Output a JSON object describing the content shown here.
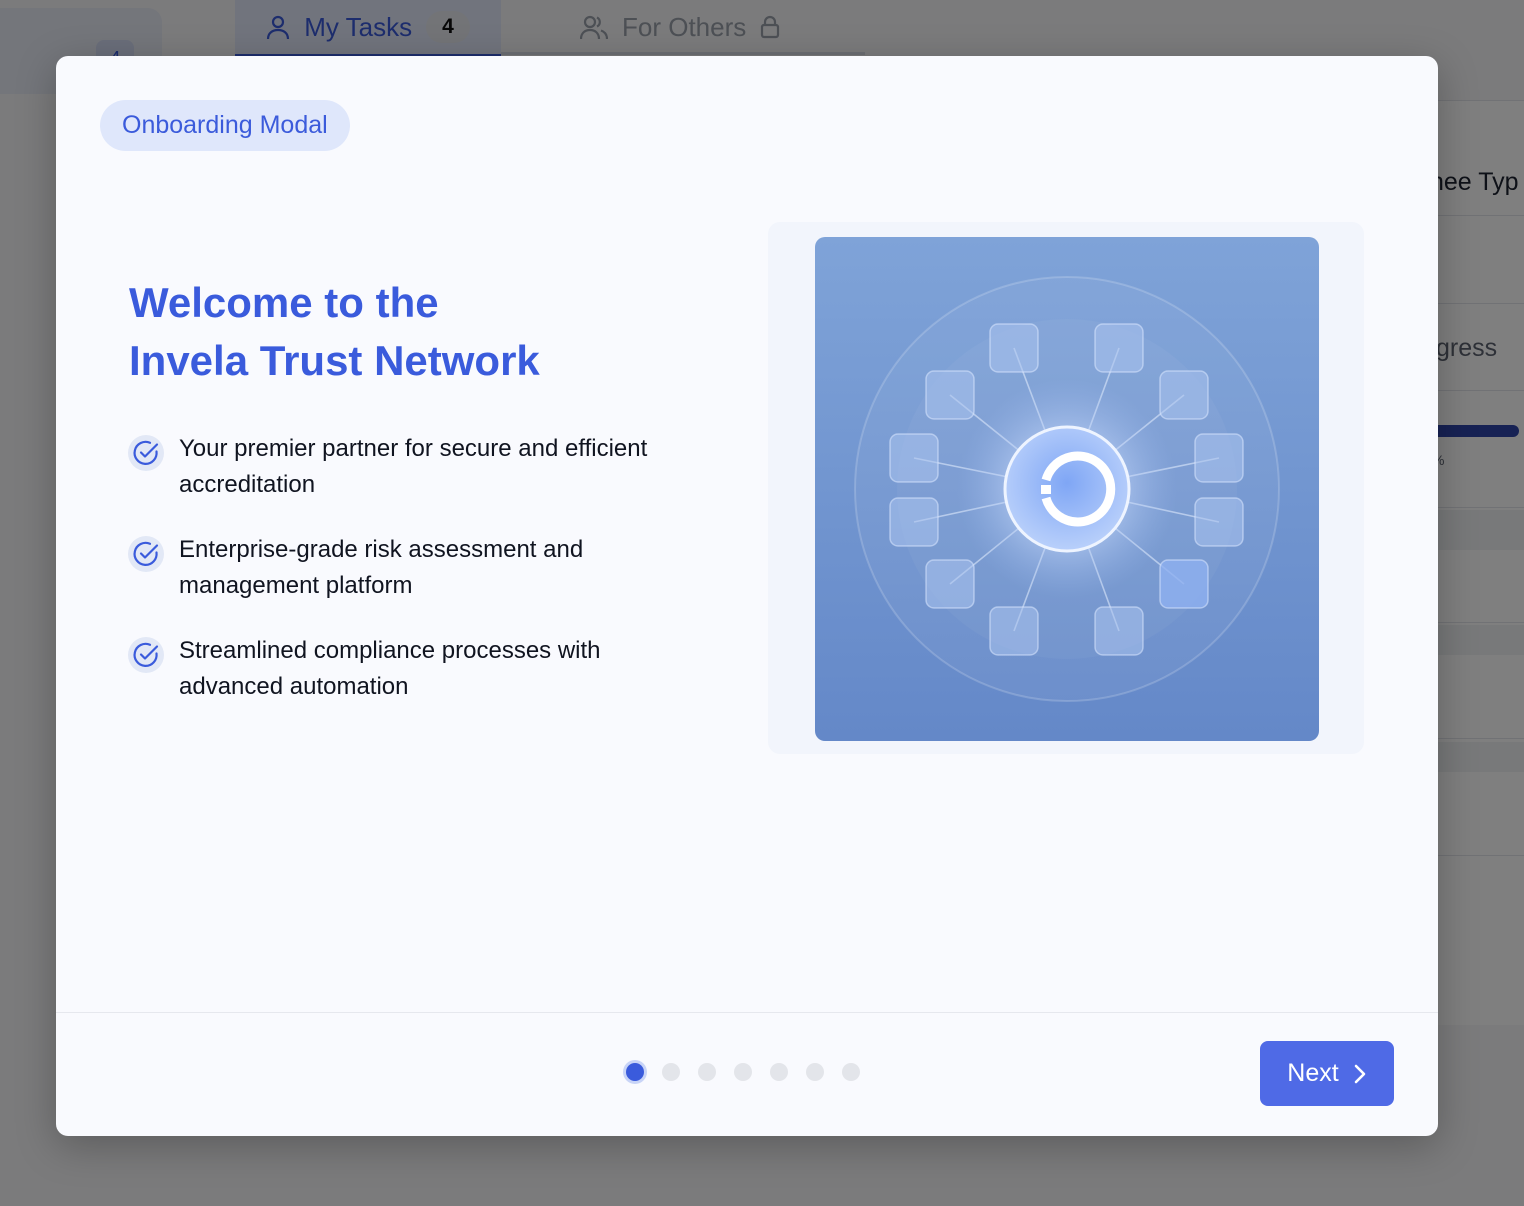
{
  "background": {
    "left_badge": "4",
    "tabs": [
      {
        "label": "My Tasks",
        "count": "4",
        "icon": "user-icon"
      },
      {
        "label": "For Others",
        "icon": "users-icon",
        "lock_icon": "lock-icon"
      }
    ],
    "table": {
      "header_fragment": "nee Typ",
      "status_fragment": "gress",
      "progress_pct": "%",
      "progress_fraction": 1.0
    }
  },
  "modal": {
    "pill": "Onboarding Modal",
    "title_line1": "Welcome to the",
    "title_line2": "Invela Trust Network",
    "features": [
      {
        "line1": "Your premier partner for secure and efficient",
        "line2": "accreditation"
      },
      {
        "line1": "Enterprise-grade risk assessment and",
        "line2": "management platform"
      },
      {
        "line1": "Streamlined compliance processes with",
        "line2": "advanced automation"
      }
    ],
    "pagination": {
      "total": 7,
      "current": 1
    },
    "next_label": "Next"
  },
  "colors": {
    "accent": "#3a5bdc",
    "button": "#4f6ae6",
    "pill_bg": "#dfe7fb"
  }
}
